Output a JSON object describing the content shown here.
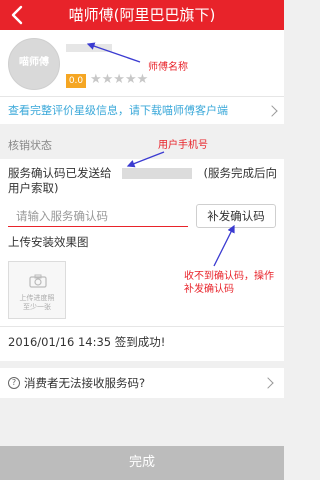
{
  "header": {
    "title": "喵师傅(阿里巴巴旗下)",
    "back_icon": "back-icon"
  },
  "profile": {
    "avatar_text": "喵师傅",
    "score": "0.0",
    "stars": "★★★★★"
  },
  "annotations": {
    "master_name": "师傅名称",
    "user_phone": "用户手机号",
    "resend_note": "收不到确认码，操作补发确认码"
  },
  "rating_link": {
    "text": "查看完整评价星级信息，请下载喵师傅客户端"
  },
  "section": {
    "label": "核销状态"
  },
  "verify": {
    "description": "服务确认码已发送给　　　　　　　　(服务完成后向用户索取)",
    "input_placeholder": "请输入服务确认码",
    "resend_label": "补发确认码",
    "upload_label": "上传安装效果图",
    "upload_hint": "上传进度照\n至少一张",
    "checkin_text": "2016/01/16 14:35 签到成功!"
  },
  "help": {
    "text": "消费者无法接收服务码?"
  },
  "footer": {
    "done_label": "完成"
  },
  "colors": {
    "brand_red": "#e8232a",
    "link_blue": "#3aa8d9",
    "star_gray": "#c8c8c8",
    "score_orange": "#f5a623",
    "disabled_gray": "#bcbcbc"
  }
}
